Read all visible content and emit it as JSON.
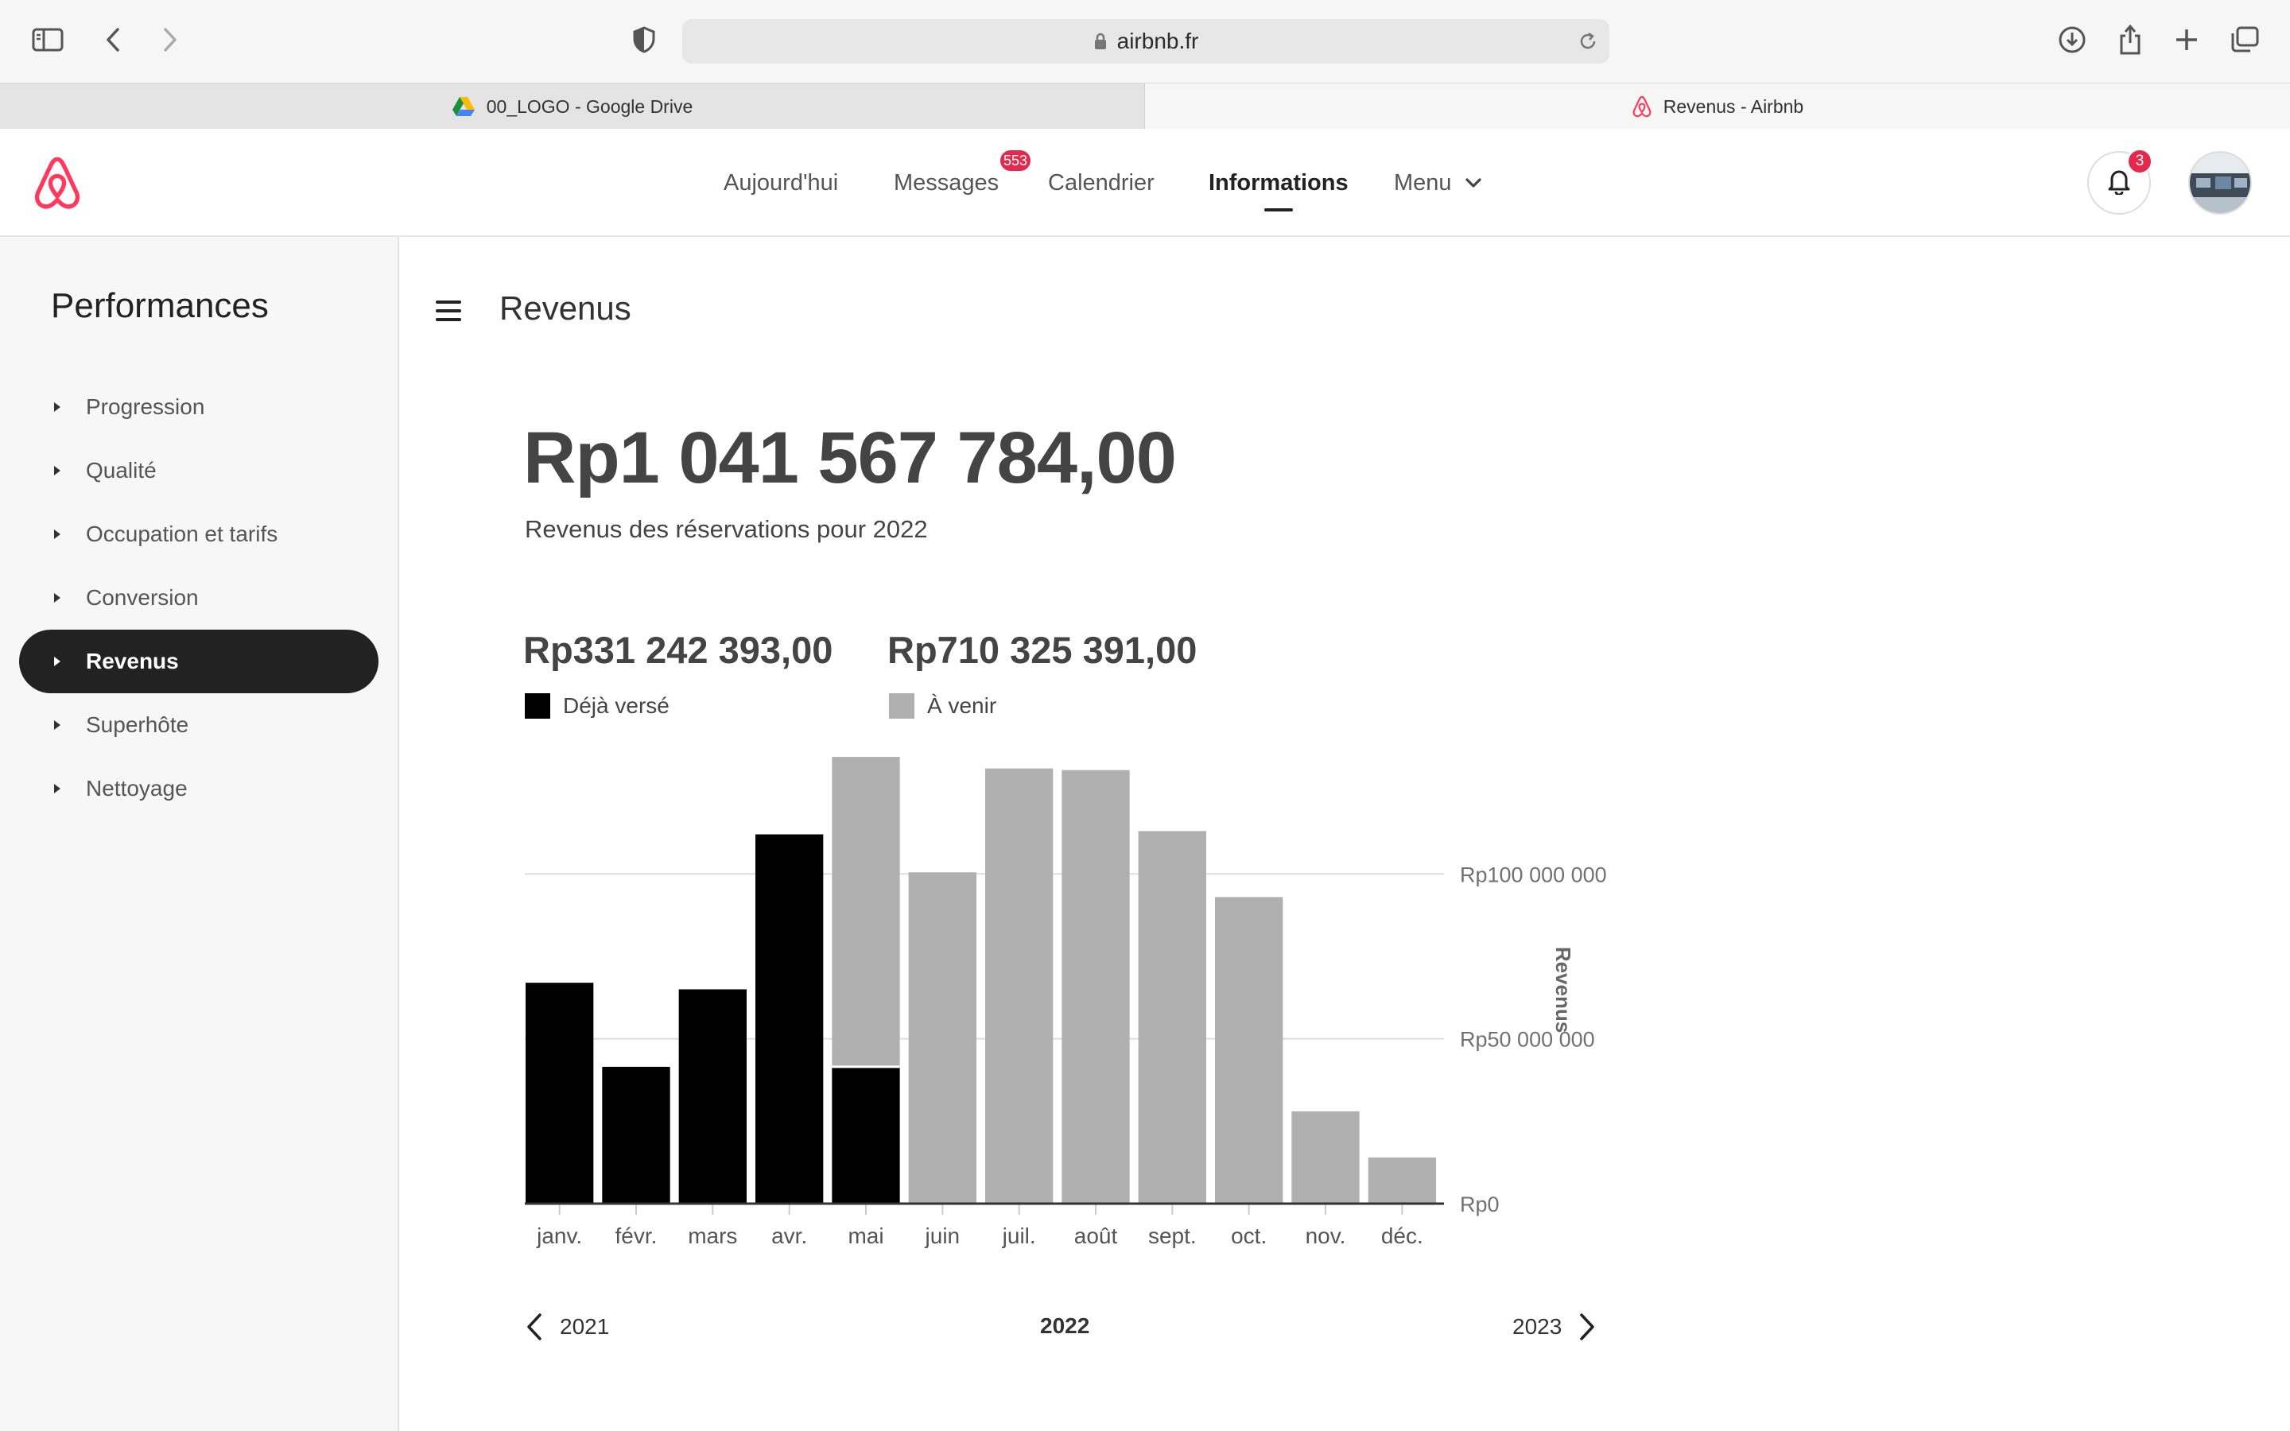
{
  "browser": {
    "url": "airbnb.fr",
    "tabs": [
      {
        "title": "00_LOGO - Google Drive",
        "active": false
      },
      {
        "title": "Revenus - Airbnb",
        "active": true
      }
    ]
  },
  "header": {
    "nav": [
      {
        "label": "Aujourd'hui"
      },
      {
        "label": "Messages",
        "badge": "553"
      },
      {
        "label": "Calendrier"
      },
      {
        "label": "Informations",
        "active": true
      },
      {
        "label": "Menu"
      }
    ],
    "notifications_count": "3"
  },
  "sidebar": {
    "title": "Performances",
    "items": [
      {
        "label": "Progression"
      },
      {
        "label": "Qualité"
      },
      {
        "label": "Occupation et tarifs"
      },
      {
        "label": "Conversion"
      },
      {
        "label": "Revenus",
        "selected": true
      },
      {
        "label": "Superhôte"
      },
      {
        "label": "Nettoyage"
      }
    ]
  },
  "main": {
    "title": "Revenus",
    "total": "Rp1 041 567 784,00",
    "total_caption": "Revenus des réservations pour 2022",
    "paid": {
      "amount": "Rp331 242 393,00",
      "label": "Déjà versé"
    },
    "upcoming": {
      "amount": "Rp710 325 391,00",
      "label": "À venir"
    },
    "year_nav": {
      "prev": "2021",
      "current": "2022",
      "next": "2023"
    }
  },
  "colors": {
    "paid": "#000000",
    "upcoming": "#b0b0b0",
    "brand": "#ff385c",
    "badge": "#e5284e"
  },
  "chart_data": {
    "type": "bar",
    "stacked": true,
    "categories": [
      "janv.",
      "févr.",
      "mars",
      "avr.",
      "mai",
      "juin",
      "juil.",
      "août",
      "sept.",
      "oct.",
      "nov.",
      "déc."
    ],
    "series": [
      {
        "name": "Déjà versé",
        "values": [
          67000000,
          41500000,
          65000000,
          112000000,
          41500000,
          0,
          0,
          0,
          0,
          0,
          0,
          0
        ]
      },
      {
        "name": "À venir",
        "values": [
          0,
          0,
          0,
          0,
          94000000,
          100500000,
          132000000,
          131500000,
          113000000,
          93000000,
          28000000,
          14000000
        ]
      }
    ],
    "ylabel": "Revenus",
    "yticks": [
      "Rp0",
      "Rp50 000 000",
      "Rp100 000 000"
    ],
    "ylim": [
      0,
      136000000
    ],
    "grid": true
  }
}
